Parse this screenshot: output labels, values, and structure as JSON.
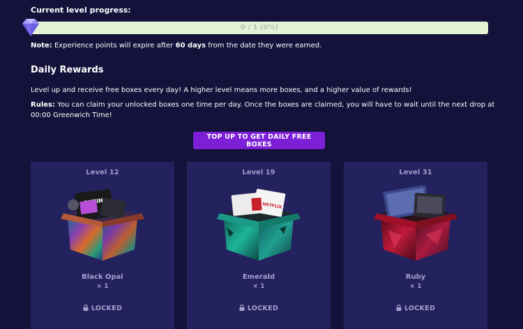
{
  "progress": {
    "label": "Current level progress:",
    "text": "0 / 1 (0%)",
    "value": 0
  },
  "note": {
    "prefix": "Note:",
    "text_before": " Experience points will expire after ",
    "highlight": "60 days",
    "text_after": " from the date they were earned."
  },
  "daily_rewards": {
    "title": "Daily Rewards",
    "description": "Level up and receive free boxes every day! A higher level means more boxes, and a higher value of rewards!",
    "rules_prefix": "Rules:",
    "rules_text": " You can claim your unlocked boxes one time per day. Once the boxes are claimed, you will have to wait until the next drop at 00:00 Greenwich Time!",
    "button_label": "TOP UP TO GET DAILY FREE BOXES"
  },
  "cards": [
    {
      "level": "Level 12",
      "name": "Black Opal",
      "quantity": "× 1",
      "status": "LOCKED"
    },
    {
      "level": "Level 19",
      "name": "Emerald",
      "quantity": "× 1",
      "status": "LOCKED"
    },
    {
      "level": "Level 31",
      "name": "Ruby",
      "quantity": "× 1",
      "status": "LOCKED"
    }
  ],
  "box_art_text": {
    "shein": "SHEIN",
    "netflix": "NETFLIX"
  },
  "colors": {
    "background": "#14123a",
    "card": "#24225e",
    "accent_button": "#7c1fd6",
    "progress_track": "#e3f3d6",
    "muted_text": "#a3a1cc"
  },
  "icons": {
    "gem": "diamond-gem-icon",
    "lock": "padlock-icon"
  }
}
